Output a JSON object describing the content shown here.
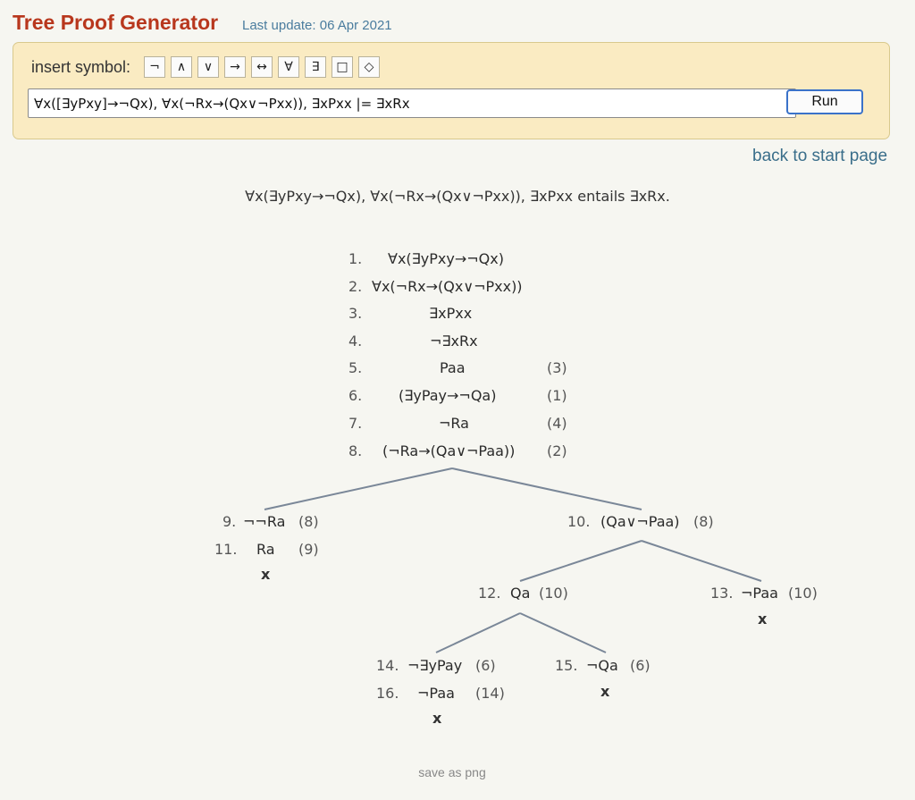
{
  "header": {
    "title": "Tree Proof Generator",
    "last_update": "Last update: 06 Apr 2021"
  },
  "input_panel": {
    "insert_label": "insert symbol:",
    "symbols": [
      "¬",
      "∧",
      "∨",
      "→",
      "↔",
      "∀",
      "∃",
      "□",
      "◇"
    ],
    "formula_value": "∀x([∃yPxy]→¬Qx), ∀x(¬Rx→(Qx∨¬Pxx)), ∃xPxx |= ∃xRx",
    "run_label": "Run"
  },
  "back_link": "back to start page",
  "summary": "∀x(∃yPxy→¬Qx), ∀x(¬Rx→(Qx∨¬Pxx)), ∃xPxx entails ∃xRx.",
  "tree": {
    "lines": [
      {
        "num": "1.",
        "formula": "∀x(∃yPxy→¬Qx)",
        "reason": ""
      },
      {
        "num": "2.",
        "formula": "∀x(¬Rx→(Qx∨¬Pxx))",
        "reason": ""
      },
      {
        "num": "3.",
        "formula": "∃xPxx",
        "reason": ""
      },
      {
        "num": "4.",
        "formula": "¬∃xRx",
        "reason": ""
      },
      {
        "num": "5.",
        "formula": "Paa",
        "reason": "(3)"
      },
      {
        "num": "6.",
        "formula": "(∃yPay→¬Qa)",
        "reason": "(1)"
      },
      {
        "num": "7.",
        "formula": "¬Ra",
        "reason": "(4)"
      },
      {
        "num": "8.",
        "formula": "(¬Ra→(Qa∨¬Paa))",
        "reason": "(2)"
      },
      {
        "num": "9.",
        "formula": "¬¬Ra",
        "reason": "(8)"
      },
      {
        "num": "11.",
        "formula": "Ra",
        "reason": "(9)"
      },
      {
        "num": "10.",
        "formula": "(Qa∨¬Paa)",
        "reason": "(8)"
      },
      {
        "num": "12.",
        "formula": "Qa",
        "reason": "(10)"
      },
      {
        "num": "13.",
        "formula": "¬Paa",
        "reason": "(10)"
      },
      {
        "num": "14.",
        "formula": "¬∃yPay",
        "reason": "(6)"
      },
      {
        "num": "16.",
        "formula": "¬Paa",
        "reason": "(14)"
      },
      {
        "num": "15.",
        "formula": "¬Qa",
        "reason": "(6)"
      }
    ],
    "closed_mark": "x"
  },
  "footer": {
    "save_png": "save as png"
  },
  "colors": {
    "title": "#b8371d",
    "link": "#3a6e8a",
    "panel_bg": "#faebc2",
    "page_bg": "#f6f6f1",
    "tree_lines": "#7a8798"
  }
}
